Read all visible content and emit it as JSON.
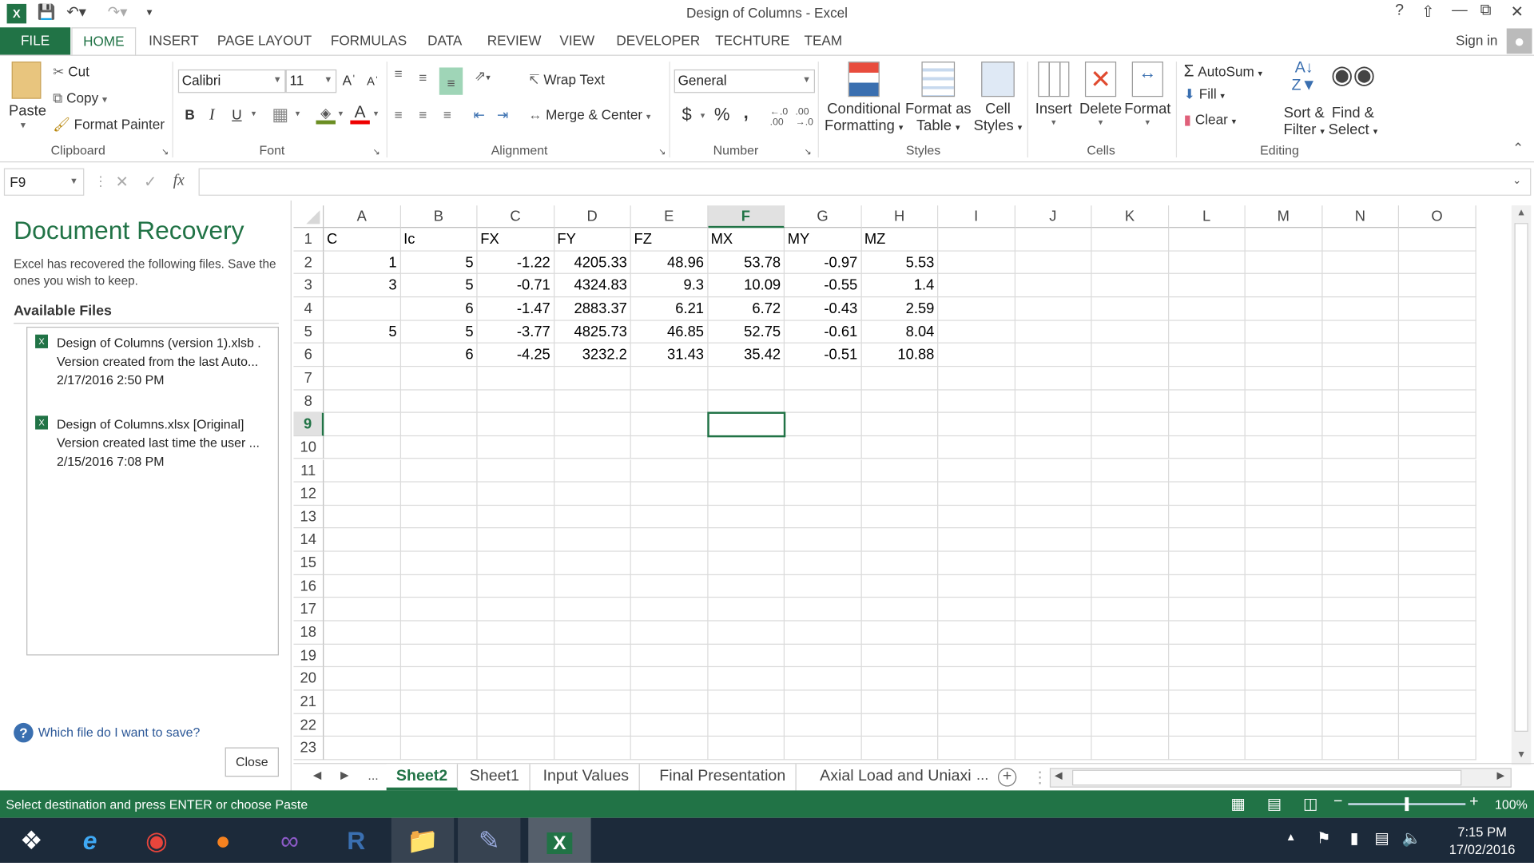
{
  "window": {
    "title": "Design of Columns - Excel",
    "help": "?",
    "sign_in": "Sign in"
  },
  "ribbon_tabs": [
    "FILE",
    "HOME",
    "INSERT",
    "PAGE LAYOUT",
    "FORMULAS",
    "DATA",
    "REVIEW",
    "VIEW",
    "DEVELOPER",
    "TECHTURE",
    "TEAM"
  ],
  "clipboard": {
    "paste": "Paste",
    "cut": "Cut",
    "copy": "Copy",
    "format_painter": "Format Painter",
    "label": "Clipboard"
  },
  "font": {
    "name": "Calibri",
    "size": "11",
    "bold": "B",
    "italic": "I",
    "underline": "U",
    "label": "Font"
  },
  "alignment": {
    "wrap": "Wrap Text",
    "merge": "Merge & Center",
    "label": "Alignment"
  },
  "number": {
    "format": "General",
    "currency": "$",
    "percent": "%",
    "comma": ",",
    "label": "Number"
  },
  "styles": {
    "conditional": [
      "Conditional",
      "Formatting"
    ],
    "table": [
      "Format as",
      "Table"
    ],
    "cell": [
      "Cell",
      "Styles"
    ],
    "label": "Styles"
  },
  "cells": {
    "insert": "Insert",
    "delete": "Delete",
    "format": "Format",
    "label": "Cells"
  },
  "editing": {
    "autosum": "AutoSum",
    "fill": "Fill",
    "clear": "Clear",
    "sort": [
      "Sort &",
      "Filter"
    ],
    "find": [
      "Find &",
      "Select"
    ],
    "label": "Editing"
  },
  "formula_bar": {
    "name_box": "F9",
    "fx": "fx",
    "value": ""
  },
  "recovery": {
    "title": "Document Recovery",
    "description": "Excel has recovered the following files.  Save the ones you wish to keep.",
    "available": "Available Files",
    "files": [
      {
        "name": "Design of Columns (version 1).xlsb .",
        "desc": "Version created from the last Auto...",
        "date": "2/17/2016 2:50 PM"
      },
      {
        "name": "Design of Columns.xlsx  [Original]",
        "desc": "Version created last time the user ...",
        "date": "2/15/2016 7:08 PM"
      }
    ],
    "help_link": "Which file do I want to save?",
    "close": "Close"
  },
  "sheet": {
    "columns": [
      "A",
      "B",
      "C",
      "D",
      "E",
      "F",
      "G",
      "H",
      "I",
      "J",
      "K",
      "L",
      "M",
      "N",
      "O"
    ],
    "row_count": 23,
    "selected_cell": "F9",
    "rows": [
      [
        "C",
        "Ic",
        "FX",
        "FY",
        "FZ",
        "MX",
        "MY",
        "MZ"
      ],
      [
        "1",
        "5",
        "-1.22",
        "4205.33",
        "48.96",
        "53.78",
        "-0.97",
        "5.53"
      ],
      [
        "3",
        "5",
        "-0.71",
        "4324.83",
        "9.3",
        "10.09",
        "-0.55",
        "1.4"
      ],
      [
        "",
        "6",
        "-1.47",
        "2883.37",
        "6.21",
        "6.72",
        "-0.43",
        "2.59"
      ],
      [
        "5",
        "5",
        "-3.77",
        "4825.73",
        "46.85",
        "52.75",
        "-0.61",
        "8.04"
      ],
      [
        "",
        "6",
        "-4.25",
        "3232.2",
        "31.43",
        "35.42",
        "-0.51",
        "10.88"
      ]
    ]
  },
  "sheet_tabs": [
    "Sheet2",
    "Sheet1",
    "Input Values",
    "Final Presentation",
    "Axial Load and Uniaxi"
  ],
  "active_sheet": "Sheet2",
  "ellipsis": "...",
  "status": {
    "message": "Select destination and press ENTER or choose Paste",
    "zoom": "100%",
    "zoom_level": 100
  },
  "taskbar": {
    "time": "7:15 PM",
    "date": "17/02/2016",
    "apps": [
      "windows-start",
      "internet-explorer",
      "chrome",
      "firefox",
      "visual-studio",
      "revit",
      "file-explorer",
      "notepad",
      "excel"
    ]
  },
  "colors": {
    "accent": "#217346"
  }
}
